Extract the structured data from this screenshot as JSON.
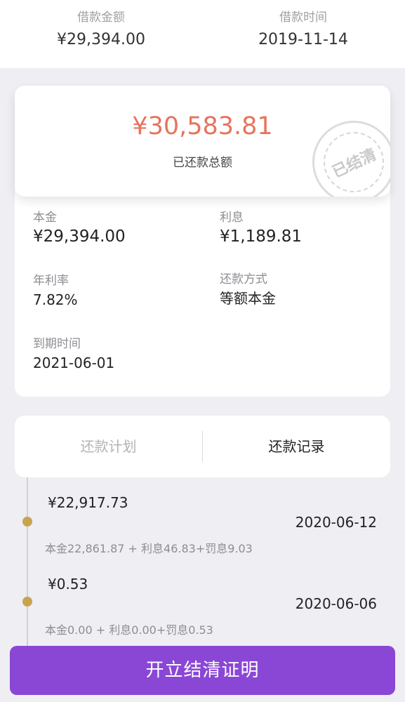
{
  "header": {
    "loan_amount_label": "借款金额",
    "loan_amount": "¥29,394.00",
    "loan_date_label": "借款时间",
    "loan_date": "2019-11-14"
  },
  "summary": {
    "total_repaid": "¥30,583.81",
    "total_repaid_label": "已还款总额",
    "stamp_text": "已结清"
  },
  "details": {
    "principal_label": "本金",
    "principal": "¥29,394.00",
    "interest_label": "利息",
    "interest": "¥1,189.81",
    "annual_rate_label": "年利率",
    "annual_rate": "7.82%",
    "repayment_method_label": "还款方式",
    "repayment_method": "等额本金",
    "due_date_label": "到期时间",
    "due_date": "2021-06-01"
  },
  "tabs": {
    "plan": "还款计划",
    "records": "还款记录",
    "active": "records"
  },
  "records": [
    {
      "amount": "¥22,917.73",
      "date": "2020-06-12",
      "detail": "本金22,861.87 + 利息46.83+罚息9.03"
    },
    {
      "amount": "¥0.53",
      "date": "2020-06-06",
      "detail": "本金0.00 + 利息0.00+罚息0.53"
    }
  ],
  "button": {
    "label": "开立结清证明"
  },
  "colors": {
    "accent": "#8a47d6",
    "amount": "#e8735d",
    "timeline_dot": "#c9a253"
  }
}
